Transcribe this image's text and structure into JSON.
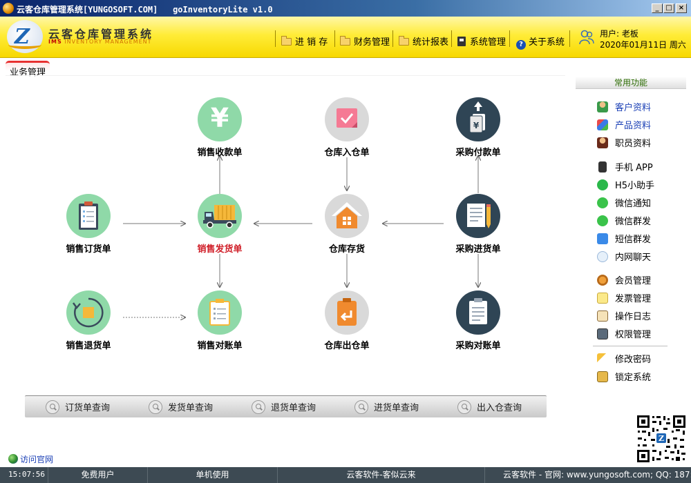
{
  "window": {
    "title_cn": "云客仓库管理系统",
    "title_brand": "[YUNGOSOFT.COM]",
    "title_app": "goInventoryLite v1.0",
    "controls": [
      "_",
      "□",
      "×"
    ]
  },
  "header": {
    "brand_cn": "云客仓库管理系统",
    "brand_en_ims": "IMS",
    "brand_en_rest": "INVENTORY MANAGEMENT",
    "nav": [
      {
        "label": "进 销 存",
        "icon": "folder-icon"
      },
      {
        "label": "财务管理",
        "icon": "folder-icon"
      },
      {
        "label": "统计报表",
        "icon": "folder-icon"
      },
      {
        "label": "系统管理",
        "icon": "settings-icon"
      },
      {
        "label": "关于系统",
        "icon": "help-icon"
      }
    ],
    "user": "用户: 老板",
    "date": "2020年01月11日 周六"
  },
  "tab": {
    "label": "业务管理"
  },
  "flow": {
    "nodes": {
      "sales_receipt": "销售收款单",
      "warehouse_in": "仓库入仓单",
      "purchase_payment": "采购付款单",
      "sales_order": "销售订货单",
      "sales_delivery": "销售发货单",
      "warehouse_stock": "仓库存货",
      "purchase_in": "采购进货单",
      "sales_return": "销售退货单",
      "sales_reconcile": "销售对账单",
      "warehouse_out": "仓库出仓单",
      "purchase_reconcile": "采购对账单"
    },
    "icons": {
      "yen_symbol": "¥",
      "yen_doc": "¥"
    }
  },
  "query_bar": [
    "订货单查询",
    "发货单查询",
    "退货单查询",
    "进货单查询",
    "出入仓查询"
  ],
  "side_panel": {
    "header": "常用功能",
    "group1": [
      "客户资料",
      "产品资料",
      "职员资料"
    ],
    "group2": [
      "手机 APP",
      "H5小助手",
      "微信通知",
      "微信群发",
      "短信群发",
      "内网聊天"
    ],
    "group3": [
      "会员管理",
      "发票管理",
      "操作日志",
      "权限管理"
    ],
    "group4": [
      "修改密码",
      "锁定系统"
    ]
  },
  "visit_link": "访问官网",
  "statusbar": {
    "time": "15:07:56",
    "license": "免费用户",
    "mode": "单机使用",
    "slogan": "云客软件-客似云来",
    "contact": "云客软件 - 官网: www.yungosoft.com; QQ: 187:"
  },
  "colors": {
    "header_yellow": "#ffec38",
    "tab_red": "#e83030",
    "node_green": "#8fd9a8",
    "node_grey": "#d9d9d9",
    "node_navy": "#2f4555",
    "delivery_label_red": "#d0202a",
    "statusbar": "#3d4a53",
    "link_blue": "#1a3fb5"
  }
}
